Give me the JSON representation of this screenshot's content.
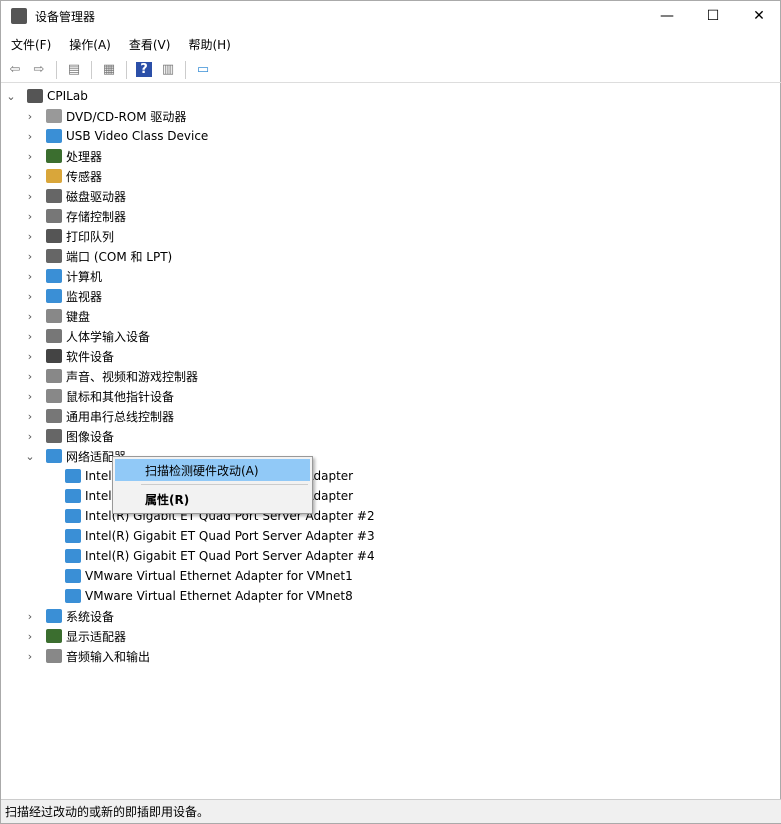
{
  "window": {
    "title": "设备管理器",
    "minimize": "—",
    "maximize": "☐",
    "close": "✕"
  },
  "menu": [
    "文件(F)",
    "操作(A)",
    "查看(V)",
    "帮助(H)"
  ],
  "toolbar": [
    {
      "icon": "back-icon",
      "glyph": "⇦"
    },
    {
      "icon": "forward-icon",
      "glyph": "⇨"
    },
    {
      "icon": "show-hide-tree-icon",
      "glyph": "▤"
    },
    {
      "icon": "properties-icon",
      "glyph": "▦"
    },
    {
      "icon": "help-icon",
      "glyph": "?"
    },
    {
      "icon": "run-icon",
      "glyph": "▥"
    },
    {
      "icon": "monitor-icon",
      "glyph": "▭"
    }
  ],
  "tree": {
    "root": "CPILab",
    "categories": [
      {
        "label": "DVD/CD-ROM 驱动器",
        "color": "#999"
      },
      {
        "label": "USB Video Class Device",
        "color": "#3a8fd6"
      },
      {
        "label": "处理器",
        "color": "#3b6e2f"
      },
      {
        "label": "传感器",
        "color": "#d9a63a"
      },
      {
        "label": "磁盘驱动器",
        "color": "#666"
      },
      {
        "label": "存储控制器",
        "color": "#777"
      },
      {
        "label": "打印队列",
        "color": "#555"
      },
      {
        "label": "端口 (COM 和 LPT)",
        "color": "#666"
      },
      {
        "label": "计算机",
        "color": "#3a8fd6"
      },
      {
        "label": "监视器",
        "color": "#3a8fd6"
      },
      {
        "label": "键盘",
        "color": "#888"
      },
      {
        "label": "人体学输入设备",
        "color": "#777"
      },
      {
        "label": "软件设备",
        "color": "#444"
      },
      {
        "label": "声音、视频和游戏控制器",
        "color": "#888"
      },
      {
        "label": "鼠标和其他指针设备",
        "color": "#888"
      },
      {
        "label": "通用串行总线控制器",
        "color": "#777"
      },
      {
        "label": "图像设备",
        "color": "#666"
      },
      {
        "label": "网络适配器",
        "color": "#3a8fd6",
        "expanded": true,
        "children": [
          "Intel(R) Gigabit ET Quad Port Server Adapter",
          "Intel(R) Gigabit ET Quad Port Server Adapter",
          "Intel(R) Gigabit ET Quad Port Server Adapter #2",
          "Intel(R) Gigabit ET Quad Port Server Adapter #3",
          "Intel(R) Gigabit ET Quad Port Server Adapter #4",
          "VMware Virtual Ethernet Adapter for VMnet1",
          "VMware Virtual Ethernet Adapter for VMnet8"
        ]
      },
      {
        "label": "系统设备",
        "color": "#3a8fd6"
      },
      {
        "label": "显示适配器",
        "color": "#3b6e2f"
      },
      {
        "label": "音频输入和输出",
        "color": "#888"
      }
    ]
  },
  "context_menu": {
    "scan": "扫描检测硬件改动(A)",
    "properties": "属性(R)"
  },
  "status": "扫描经过改动的或新的即插即用设备。"
}
